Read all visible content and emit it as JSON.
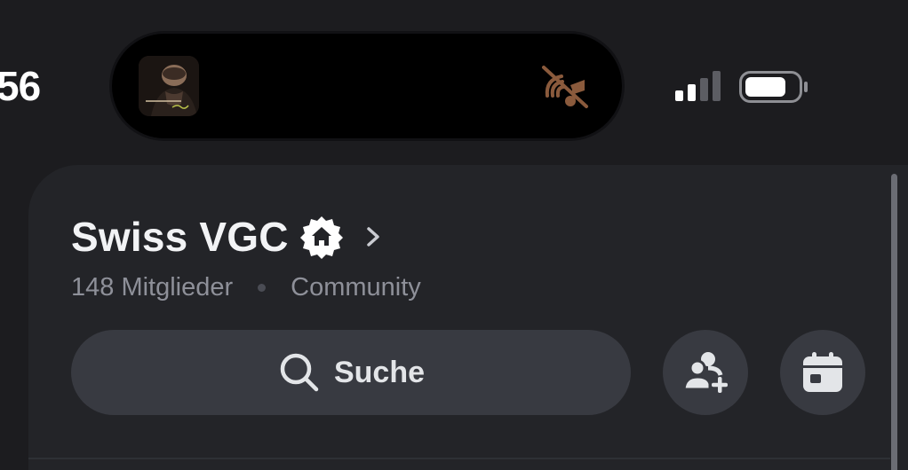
{
  "status_bar": {
    "time": "56",
    "signal_icon": "cellular-signal-icon",
    "battery_icon": "battery-icon"
  },
  "dynamic_island": {
    "album_art_icon": "album-art-thumbnail",
    "indicator_icon": "muted-music-icon",
    "indicator_color": "#8a5a3c"
  },
  "server": {
    "name": "Swiss VGC",
    "badge_icon": "community-home-badge-icon",
    "chevron_icon": "chevron-right-icon",
    "members": "148 Mitglieder",
    "type": "Community"
  },
  "actions": {
    "search_label": "Suche",
    "search_icon": "search-icon",
    "invite_icon": "add-member-icon",
    "events_icon": "calendar-icon"
  },
  "colors": {
    "background": "#1c1c1f",
    "panel": "#232428",
    "button": "#383a41",
    "muted_text": "#8e9099"
  }
}
